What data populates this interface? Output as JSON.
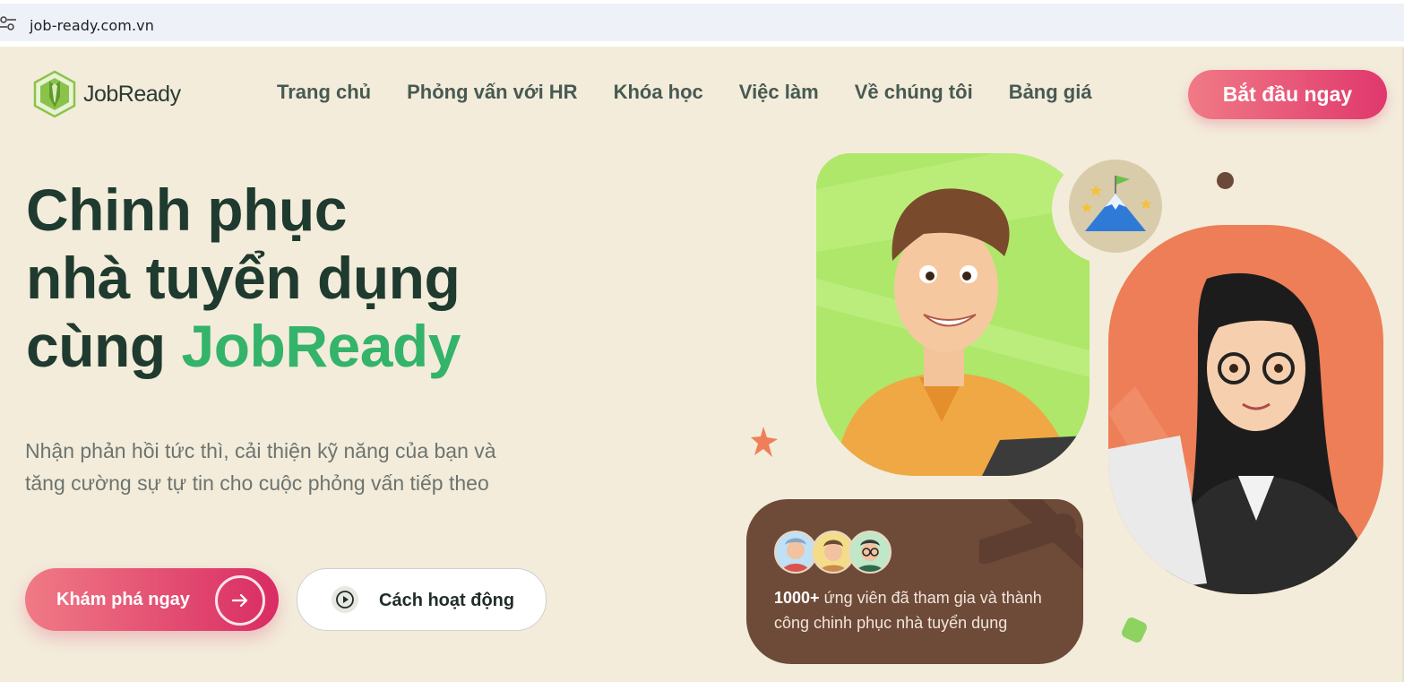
{
  "browser": {
    "url": "job-ready.com.vn",
    "site_info_icon": "tune-icon"
  },
  "header": {
    "logo_text": "JobReady",
    "nav": [
      "Trang chủ",
      "Phỏng vấn với HR",
      "Khóa học",
      "Việc làm",
      "Về chúng tôi",
      "Bảng giá"
    ],
    "cta_label": "Bắt đầu ngay"
  },
  "hero": {
    "title_line1": "Chinh phục",
    "title_line2": "nhà tuyển dụng",
    "title_line3_prefix": "cùng ",
    "title_line3_accent": "JobReady",
    "subtitle_line1": "Nhận phản hồi tức thì, cải thiện kỹ năng của bạn và",
    "subtitle_line2": "tăng cường sự tự tin cho cuộc phỏng vấn tiếp theo",
    "primary_button": "Khám phá ngay",
    "secondary_button": "Cách hoạt động"
  },
  "stats": {
    "count": "1000+",
    "text_line1": " ứng viên đã tham gia và thành",
    "text_line2": "công chinh phục nhà tuyển dụng"
  },
  "colors": {
    "background": "#f3ecdb",
    "accent_green": "#34b36a",
    "cta_pink": "#e0386d",
    "card_green": "#aee76a",
    "card_orange": "#ed7e57",
    "card_brown": "#6e4a39"
  }
}
